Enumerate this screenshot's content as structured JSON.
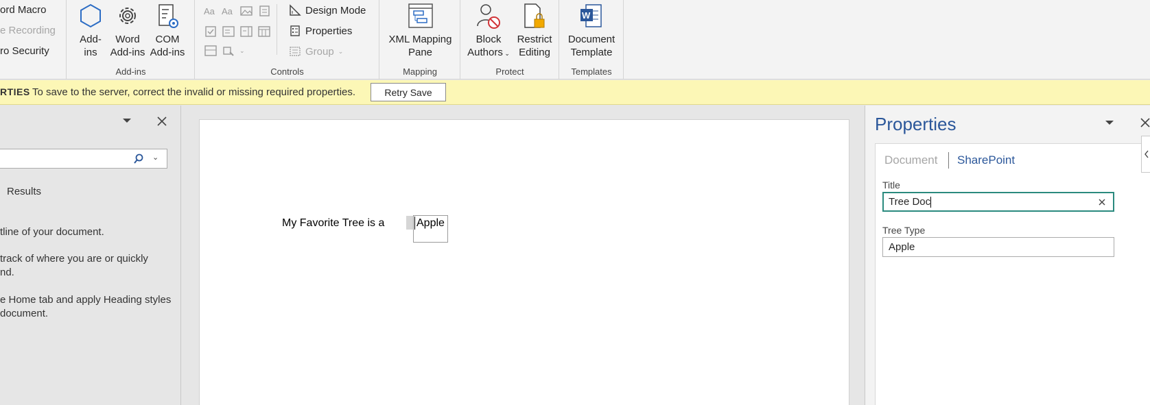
{
  "ribbon": {
    "code": {
      "record_macro": "ord Macro",
      "pause_recording": "e Recording",
      "macro_security": "ro Security"
    },
    "addins": {
      "label": "Add-ins",
      "addins_line1": "Add-",
      "addins_line2": "ins",
      "word_addins_line1": "Word",
      "word_addins_line2": "Add-ins",
      "com_addins_line1": "COM",
      "com_addins_line2": "Add-ins"
    },
    "controls": {
      "label": "Controls",
      "design_mode": "Design Mode",
      "properties": "Properties",
      "group": "Group"
    },
    "mapping": {
      "label": "Mapping",
      "xml_line1": "XML Mapping",
      "xml_line2": "Pane"
    },
    "protect": {
      "label": "Protect",
      "block_line1": "Block",
      "block_line2": "Authors",
      "restrict_line1": "Restrict",
      "restrict_line2": "Editing"
    },
    "templates": {
      "label": "Templates",
      "doc_template_line1": "Document",
      "doc_template_line2": "Template"
    }
  },
  "message_bar": {
    "title": "RTIES",
    "text": "To save to the server, correct the invalid or missing required properties.",
    "retry_label": "Retry Save"
  },
  "nav_pane": {
    "results_tab": "Results",
    "line1": "tline of your document.",
    "line2": "track of where you are or quickly",
    "line3": "nd.",
    "line4": "e Home tab and apply Heading styles",
    "line5": "document."
  },
  "document": {
    "sentence": "My Favorite Tree is a",
    "control_value": "Apple"
  },
  "properties_pane": {
    "title": "Properties",
    "tab_document": "Document",
    "tab_sharepoint": "SharePoint",
    "title_label": "Title",
    "title_value": "Tree Doc",
    "tree_type_label": "Tree Type",
    "tree_type_value": "Apple"
  },
  "colors": {
    "accent_blue": "#2b579a",
    "focus_teal": "#2a8a7e",
    "message_bar": "#fcf7b6",
    "ribbon_bg": "#f3f3f3"
  }
}
